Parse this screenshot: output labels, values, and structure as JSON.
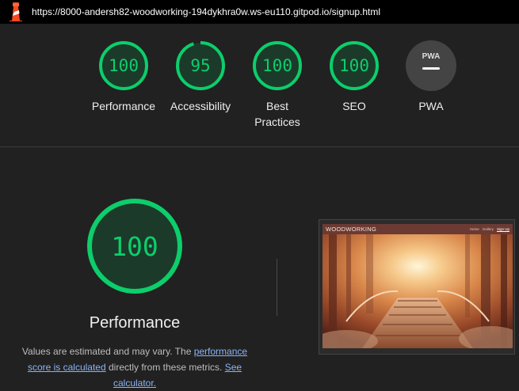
{
  "browser": {
    "url": "https://8000-andersh82-woodworking-194dykhra0w.ws-eu110.gitpod.io/signup.html",
    "logo_icon": "lighthouse-icon"
  },
  "summary": {
    "categories": [
      {
        "id": "performance",
        "label": "Performance",
        "score": "100",
        "fraction": 1.0
      },
      {
        "id": "accessibility",
        "label": "Accessibility",
        "score": "95",
        "fraction": 0.95
      },
      {
        "id": "best-practices",
        "label": "Best Practices",
        "score": "100",
        "fraction": 1.0
      },
      {
        "id": "seo",
        "label": "SEO",
        "score": "100",
        "fraction": 1.0
      },
      {
        "id": "pwa",
        "label": "PWA",
        "badge": "PWA",
        "score": null
      }
    ]
  },
  "detail": {
    "score": "100",
    "title": "Performance",
    "desc_prefix": "Values are estimated and may vary. The ",
    "desc_link1": "performance score is calculated",
    "desc_middle": " directly from these metrics. ",
    "desc_link2": "See calculator."
  },
  "screenshot": {
    "brand": "WOODWORKING",
    "nav_links": [
      "Home",
      "Gallery",
      "Sign Up"
    ],
    "active_link": "Sign Up"
  },
  "colors": {
    "pass": "#0cce6b",
    "pass_track": "#1c3a2a",
    "background": "#212121",
    "link": "#8ab4f8"
  }
}
